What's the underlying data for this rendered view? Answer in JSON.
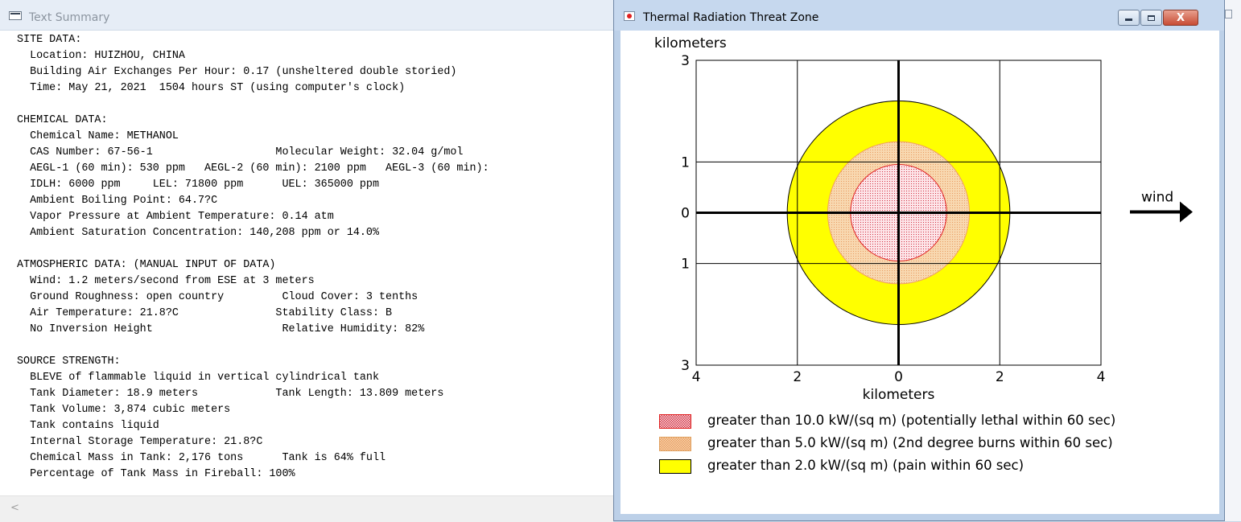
{
  "text_window": {
    "title": "Text Summary",
    "lines": [
      "SITE DATA:",
      "  Location: HUIZHOU, CHINA",
      "  Building Air Exchanges Per Hour: 0.17 (unsheltered double storied)",
      "  Time: May 21, 2021  1504 hours ST (using computer's clock)",
      "",
      "CHEMICAL DATA:",
      "  Chemical Name: METHANOL",
      "  CAS Number: 67-56-1                   Molecular Weight: 32.04 g/mol",
      "  AEGL-1 (60 min): 530 ppm   AEGL-2 (60 min): 2100 ppm   AEGL-3 (60 min):",
      "  IDLH: 6000 ppm     LEL: 71800 ppm      UEL: 365000 ppm",
      "  Ambient Boiling Point: 64.7?C",
      "  Vapor Pressure at Ambient Temperature: 0.14 atm",
      "  Ambient Saturation Concentration: 140,208 ppm or 14.0%",
      "",
      "ATMOSPHERIC DATA: (MANUAL INPUT OF DATA)",
      "  Wind: 1.2 meters/second from ESE at 3 meters",
      "  Ground Roughness: open country         Cloud Cover: 3 tenths",
      "  Air Temperature: 21.8?C               Stability Class: B",
      "  No Inversion Height                    Relative Humidity: 82%",
      "",
      "SOURCE STRENGTH:",
      "  BLEVE of flammable liquid in vertical cylindrical tank",
      "  Tank Diameter: 18.9 meters            Tank Length: 13.809 meters",
      "  Tank Volume: 3,874 cubic meters",
      "  Tank contains liquid",
      "  Internal Storage Temperature: 21.8?C",
      "  Chemical Mass in Tank: 2,176 tons      Tank is 64% full",
      "  Percentage of Tank Mass in Fireball: 100%"
    ],
    "scroll_left_glyph": "<"
  },
  "threat_window": {
    "title": "Thermal Radiation Threat Zone",
    "close_glyph": "X"
  },
  "chart_data": {
    "type": "threat-zone",
    "ylabel": "kilometers",
    "xlabel": "kilometers",
    "xlim": [
      -4,
      4
    ],
    "ylim": [
      -3,
      3
    ],
    "x_ticks": [
      {
        "v": -4,
        "label": "4"
      },
      {
        "v": -2,
        "label": "2"
      },
      {
        "v": 0,
        "label": "0"
      },
      {
        "v": 2,
        "label": "2"
      },
      {
        "v": 4,
        "label": "4"
      }
    ],
    "y_ticks": [
      {
        "v": 3,
        "label": "3"
      },
      {
        "v": 1,
        "label": "1"
      },
      {
        "v": 0,
        "label": "0"
      },
      {
        "v": -1,
        "label": "1"
      },
      {
        "v": -3,
        "label": "3"
      }
    ],
    "wind_label": "wind",
    "zones": [
      {
        "threshold": "2.0 kW/(sq m)",
        "radius_km": 2.2,
        "color": "#ffff00",
        "label": "greater than 2.0 kW/(sq m) (pain within 60 sec)"
      },
      {
        "threshold": "5.0 kW/(sq m)",
        "radius_km": 1.4,
        "color": "#f8d8b0",
        "label": "greater than 5.0 kW/(sq m) (2nd degree burns within 60 sec)"
      },
      {
        "threshold": "10.0 kW/(sq m)",
        "radius_km": 0.95,
        "color": "#fde4e8",
        "label": "greater than 10.0 kW/(sq m) (potentially lethal within 60 sec)"
      }
    ]
  }
}
